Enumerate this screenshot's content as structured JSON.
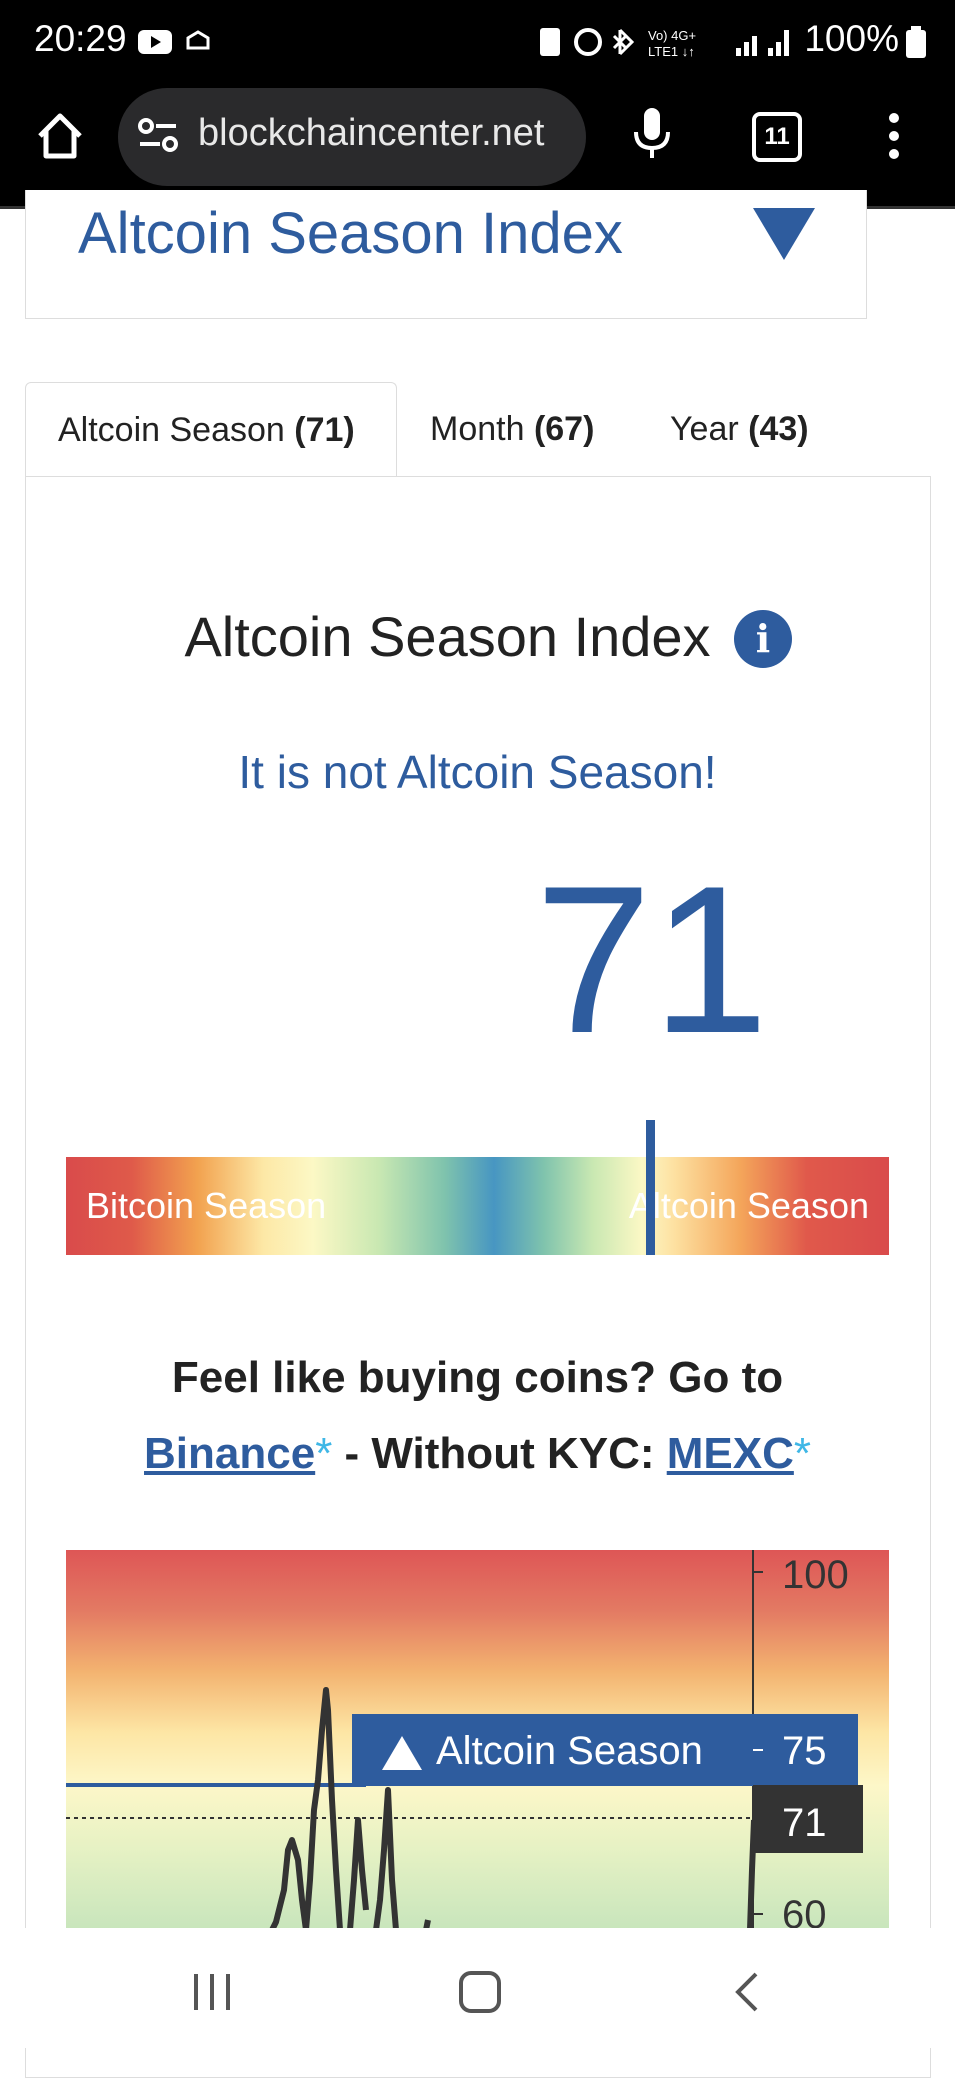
{
  "status_bar": {
    "time": "20:29",
    "battery": "100%"
  },
  "browser": {
    "url": "blockchaincenter.net",
    "tab_count": "11"
  },
  "collapsible": {
    "title": "Altcoin Season Index"
  },
  "tabs": [
    {
      "label": "Altcoin Season",
      "value": "(71)"
    },
    {
      "label": "Month",
      "value": "(67)"
    },
    {
      "label": "Year",
      "value": "(43)"
    }
  ],
  "index": {
    "title": "Altcoin Season Index",
    "status": "It is not Altcoin Season!",
    "value": "71",
    "value_fraction": 0.71,
    "bar_left_label": "Bitcoin Season",
    "bar_right_label": "Altcoin Season"
  },
  "promo": {
    "line1": "Feel like buying coins? Go to",
    "binance": "Binance",
    "star": "*",
    "mid": " - Without KYC: ",
    "mexc": "MEXC"
  },
  "chart_data": {
    "type": "line",
    "y_ticks": [
      "100",
      "75",
      "71",
      "60"
    ],
    "ylim": [
      55,
      100
    ],
    "threshold_label": "Altcoin Season",
    "threshold_value": 75,
    "current_label": "71",
    "current_value": 71
  },
  "colors": {
    "brand_blue": "#2e5c9e",
    "link_star": "#3fb7e6"
  }
}
